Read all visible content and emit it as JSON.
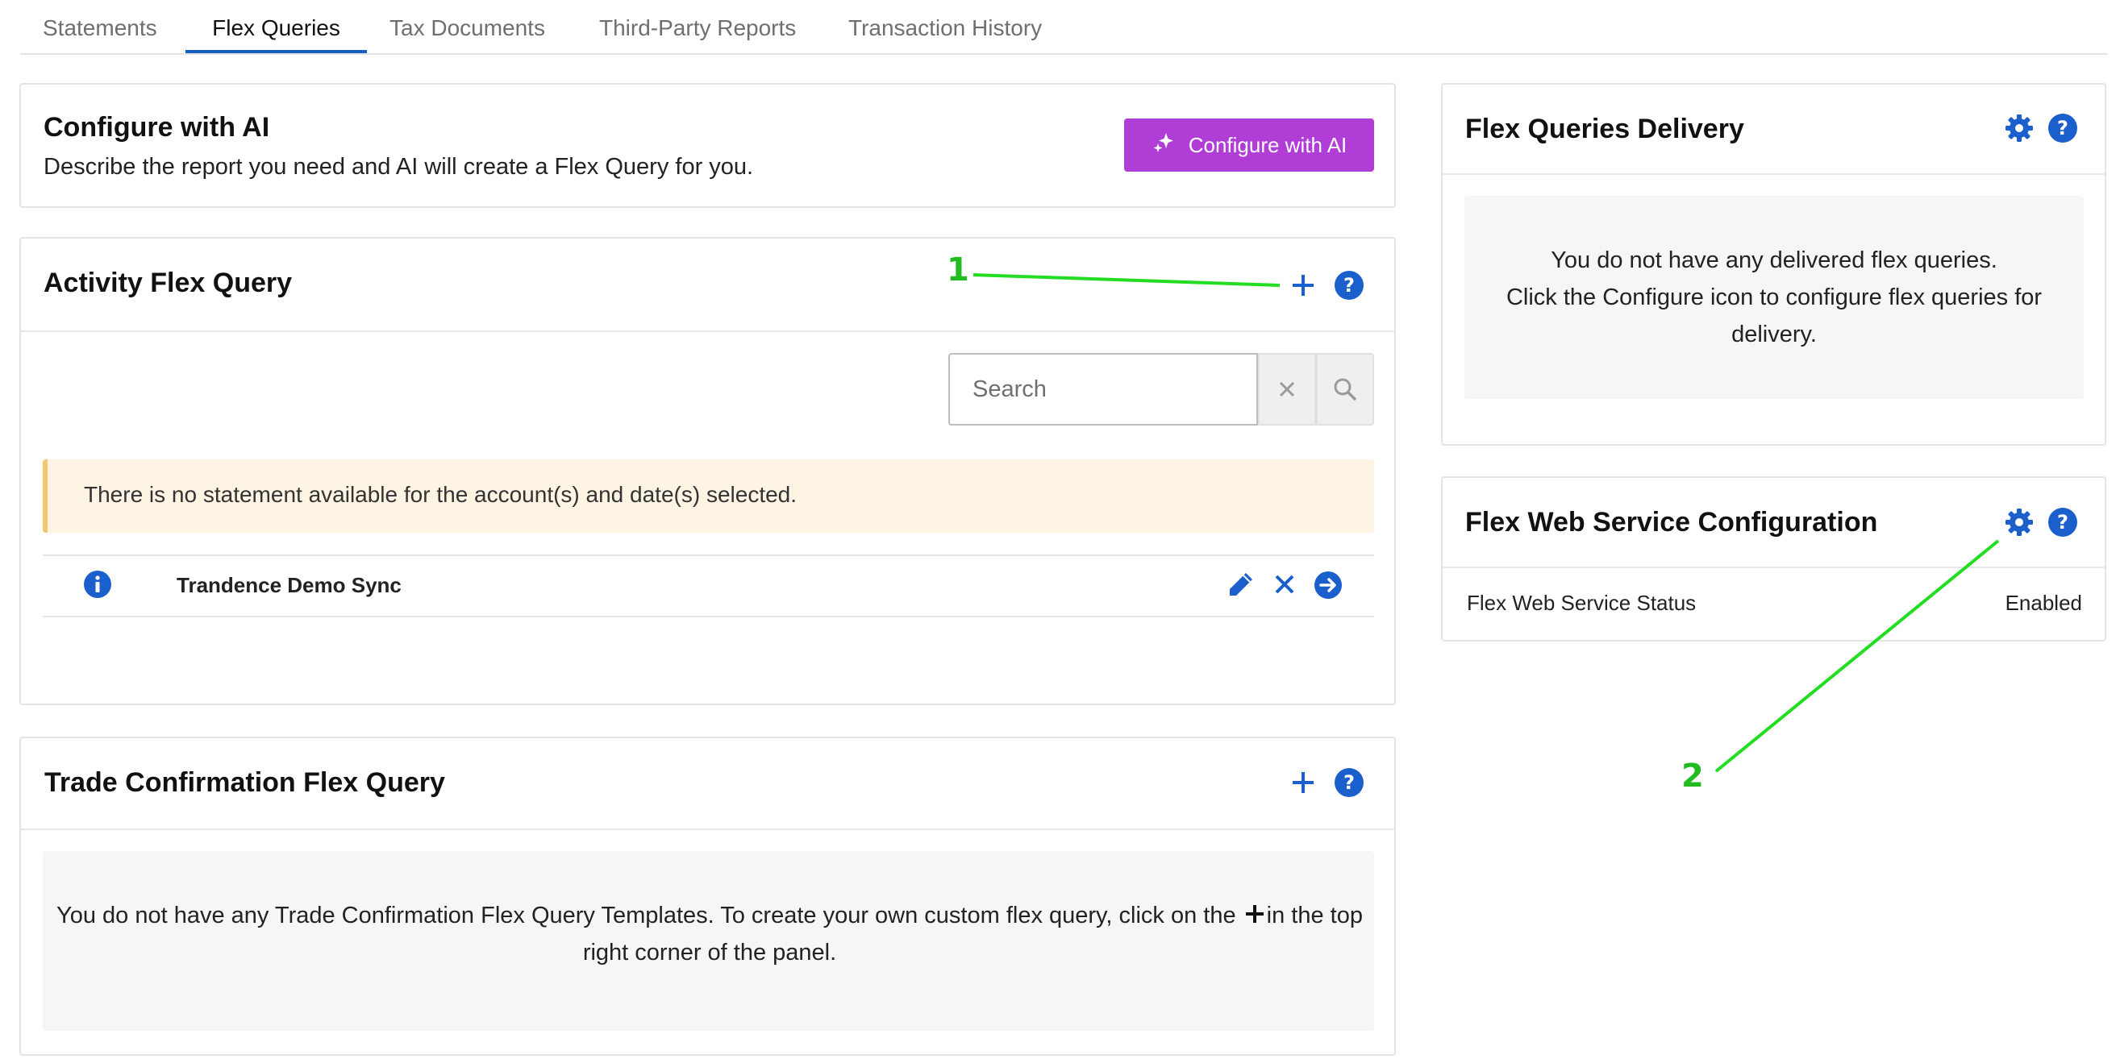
{
  "tabs": [
    {
      "label": "Statements",
      "active": false
    },
    {
      "label": "Flex Queries",
      "active": true
    },
    {
      "label": "Tax Documents",
      "active": false
    },
    {
      "label": "Third-Party Reports",
      "active": false
    },
    {
      "label": "Transaction History",
      "active": false
    }
  ],
  "configure_ai": {
    "title": "Configure with AI",
    "description": "Describe the report you need and AI will create a Flex Query for you.",
    "button_label": "Configure with AI",
    "button_color": "#b13dd7"
  },
  "activity": {
    "title": "Activity Flex Query",
    "search_placeholder": "Search",
    "alert_text": "There is no statement available for the account(s) and date(s) selected.",
    "rows": [
      {
        "name": "Trandence Demo Sync"
      }
    ]
  },
  "trade_confirmation": {
    "title": "Trade Confirmation Flex Query",
    "empty_text_before": "You do not have any Trade Confirmation Flex Query Templates. To create your own custom flex query, click on the",
    "empty_text_after": "in the top right corner of the panel."
  },
  "delivery": {
    "title": "Flex Queries Delivery",
    "empty_line1": "You do not have any delivered flex queries.",
    "empty_line2": "Click the Configure icon to configure flex queries for delivery."
  },
  "web_service": {
    "title": "Flex Web Service Configuration",
    "status_label": "Flex Web Service Status",
    "status_value": "Enabled"
  },
  "annotations": [
    {
      "label": "1",
      "target": "activity-add-button"
    },
    {
      "label": "2",
      "target": "web-service-gear-button"
    }
  ],
  "colors": {
    "accent": "#1a5fcc",
    "active_tab": "#1560bd",
    "annotation": "#22cc22"
  },
  "icons": [
    "plus-icon",
    "help-icon",
    "gear-icon",
    "info-icon",
    "pencil-icon",
    "close-icon",
    "arrow-right-circle-icon",
    "search-icon",
    "sparkle-icon"
  ]
}
